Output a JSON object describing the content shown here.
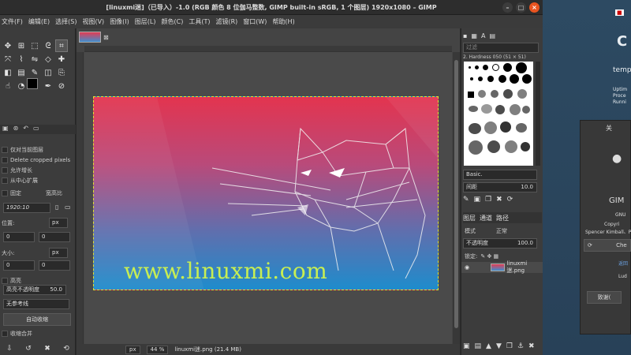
{
  "window": {
    "title": "[linuxmi迷]（已导入）-1.0 (RGB 颜色 8 位伽马整数, GIMP built-in sRGB, 1 个图层) 1920x1080 – GIMP",
    "controls": [
      "–",
      "□",
      "×"
    ]
  },
  "menu": [
    "文件(F)",
    "编辑(E)",
    "选择(S)",
    "视图(V)",
    "图像(I)",
    "图层(L)",
    "颜色(C)",
    "工具(T)",
    "滤镜(R)",
    "窗口(W)",
    "帮助(H)"
  ],
  "toolbox": {
    "tools": [
      "move-tool",
      "align-tool",
      "rect-select-tool",
      "free-select-tool",
      "crop-tool",
      "transform-tool",
      "warp-tool",
      "flip-tool",
      "perspective-tool",
      "heal-tool",
      "bucket-tool",
      "gradient-tool",
      "brush-tool",
      "eraser-tool",
      "clone-tool",
      "smudge-tool",
      "dodge-tool",
      "text-tool",
      "path-tool",
      "color-picker-tool"
    ],
    "options": {
      "opt1": "仅对当前图层",
      "opt2": "Delete cropped pixels",
      "opt3": "允许增长",
      "opt4": "从中心扩展",
      "fixed_label": "固定",
      "fixed_mode": "宽高比",
      "ratio": "1920:10",
      "position_label": "位置:",
      "position_unit": "px",
      "pos_x": "0",
      "pos_y": "0",
      "size_label": "大小:",
      "size_unit": "px",
      "size_w": "0",
      "size_h": "0",
      "highlight_label": "高亮",
      "highlight_opacity_label": "高亮不透明度",
      "highlight_opacity_value": "50.0",
      "guides": "无参考线",
      "auto_shrink": "自动收缩",
      "shrink_merged": "收缩合并"
    }
  },
  "canvas": {
    "watermark": "www.linuxmi.com",
    "unit": "px",
    "zoom": "44 %",
    "file_info": "linuxmi迷.png (21.4 MB)"
  },
  "right_dock": {
    "filter_placeholder": "过滤",
    "brush_name": "2. Hardness 050 (51 × 51)",
    "brush_preset": "Basic.",
    "spacing_label": "间距",
    "spacing_value": "10.0",
    "tabs": [
      "图层",
      "通道",
      "路径"
    ],
    "mode_label": "模式",
    "mode_value": "正常",
    "opacity_label": "不透明度",
    "opacity_value": "100.0",
    "lock_label": "锁定:",
    "layer_name": "linuxmi迷.png"
  },
  "desktop": {
    "label_temp": "temp",
    "lines": [
      "Uptim",
      "Proce",
      "Runni"
    ],
    "about_title": "GIM",
    "about_gnu": "GNU",
    "about_copyright": "Copyri",
    "about_authors": "Spencer Kimball、P",
    "about_button_che": "Che",
    "about_link": "返回",
    "about_name": "Lud",
    "about_credits": "致谢(",
    "about_top": "关"
  }
}
